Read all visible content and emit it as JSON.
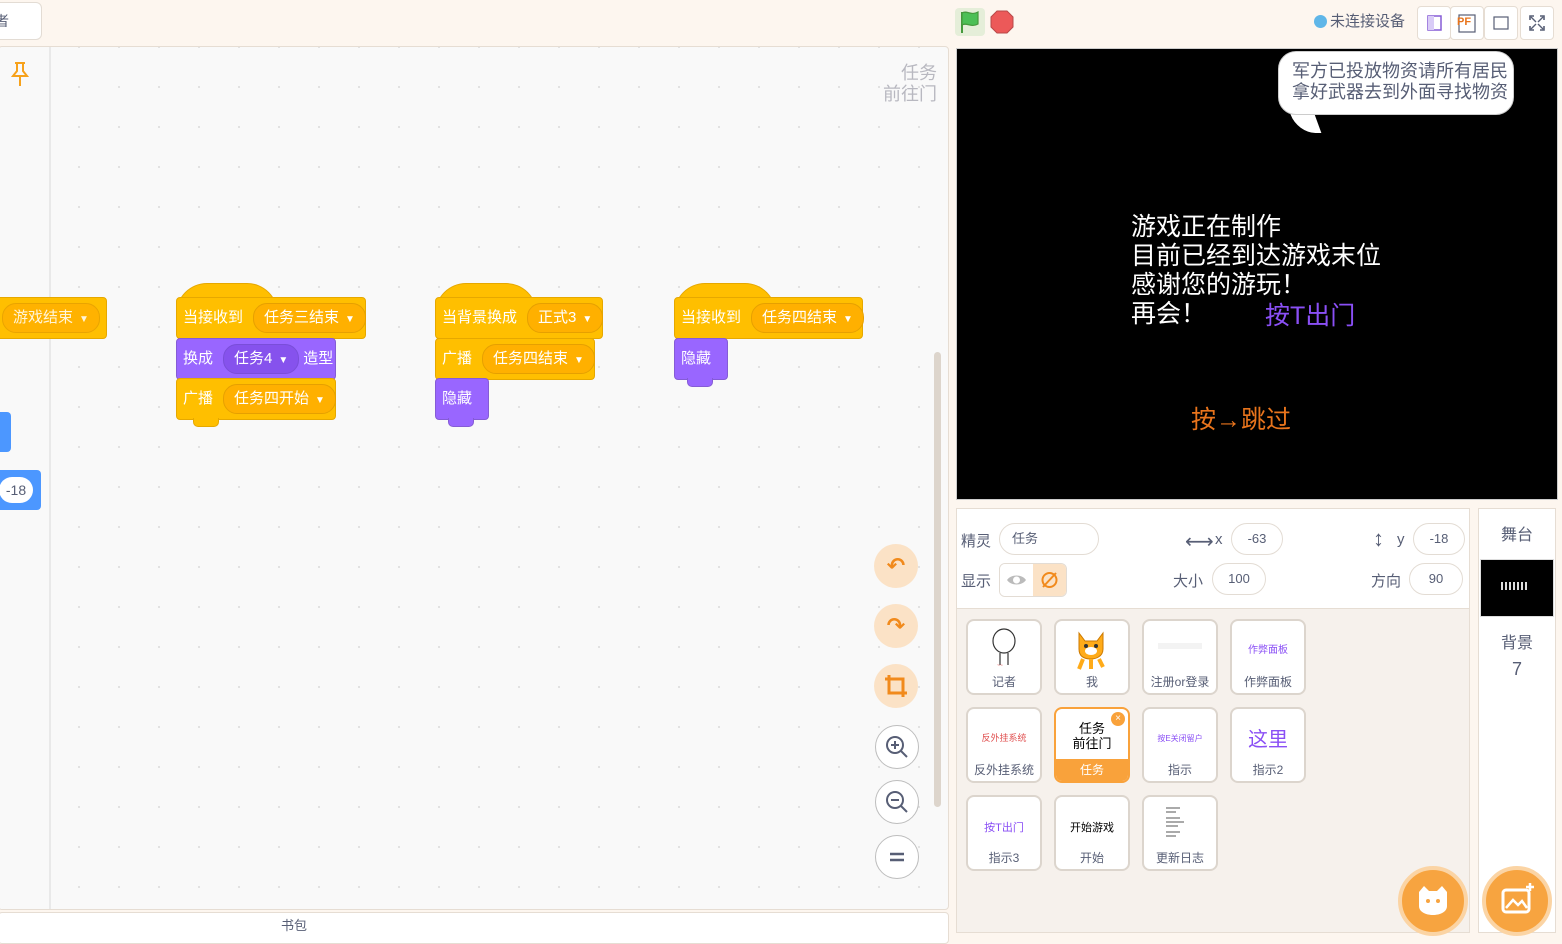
{
  "topbar": {
    "tab_stub": "者",
    "connection_status": "未连接设备",
    "icons": [
      "green-flag-icon",
      "stop-icon",
      "small-stage-icon",
      "pdf-icon",
      "stage-mode-icon",
      "fullscreen-icon"
    ],
    "colors": {
      "flag": "#4cbf56",
      "stop": "#ec5959"
    }
  },
  "code": {
    "sprite_label_line1": "任务",
    "sprite_label_line2": "前往门",
    "partial_block": {
      "dropdown": "游戏结束"
    },
    "partial_values": [
      "-18"
    ],
    "scripts": [
      {
        "hat": {
          "label": "当接收到",
          "dropdown": "任务三结束"
        },
        "blocks": [
          {
            "type": "looks",
            "label": "换成",
            "dropdown": "任务4",
            "suffix": "造型"
          },
          {
            "type": "event",
            "label": "广播",
            "dropdown": "任务四开始"
          }
        ]
      },
      {
        "hat": {
          "label": "当背景换成",
          "dropdown": "正式3"
        },
        "blocks": [
          {
            "type": "event",
            "label": "广播",
            "dropdown": "任务四结束"
          },
          {
            "type": "looks",
            "label": "隐藏"
          }
        ]
      },
      {
        "hat": {
          "label": "当接收到",
          "dropdown": "任务四结束"
        },
        "blocks": [
          {
            "type": "looks",
            "label": "隐藏"
          }
        ]
      }
    ],
    "backpack_label": "书包",
    "controls": [
      "undo-icon",
      "redo-icon",
      "crop-icon",
      "zoom-in-icon",
      "zoom-out-icon",
      "zoom-reset-icon"
    ]
  },
  "stage": {
    "bubble_line1": "军方已投放物资请所有居民",
    "bubble_line2": "拿好武器去到外面寻找物资",
    "text_line1": "游戏正在制作",
    "text_line2": "目前已经到达游戏末位",
    "text_line3": "感谢您的游玩！",
    "text_line4": "再会！",
    "hint_exit": "按T出门",
    "hint_skip": "按→跳过",
    "colors": {
      "hint_exit": "#8a4ff5",
      "hint_skip": "#e8741c"
    }
  },
  "sprite_info": {
    "sprite_label": "精灵",
    "sprite_name": "任务",
    "x_label": "x",
    "x_value": "-63",
    "y_label": "y",
    "y_value": "-18",
    "show_label": "显示",
    "size_label": "大小",
    "size_value": "100",
    "direction_label": "方向",
    "direction_value": "90"
  },
  "sprites": [
    {
      "name": "记者",
      "thumb": ""
    },
    {
      "name": "我",
      "thumb": ""
    },
    {
      "name": "注册or登录",
      "thumb": ""
    },
    {
      "name": "作弊面板",
      "thumb": "作弊面板"
    },
    {
      "name": "反外挂系统",
      "thumb": "反外挂系统"
    },
    {
      "name": "任务",
      "thumb": "任务\n前往门",
      "selected": true
    },
    {
      "name": "指示",
      "thumb": "按E关闭留户"
    },
    {
      "name": "指示2",
      "thumb": "这里"
    },
    {
      "name": "指示3",
      "thumb": "按T出门"
    },
    {
      "name": "开始",
      "thumb": "开始游戏"
    },
    {
      "name": "更新日志",
      "thumb": ""
    }
  ],
  "stage_pane": {
    "title": "舞台",
    "backdrop_label": "背景",
    "backdrop_count": "7"
  },
  "fabs": [
    "choose-sprite-icon",
    "choose-backdrop-icon"
  ]
}
